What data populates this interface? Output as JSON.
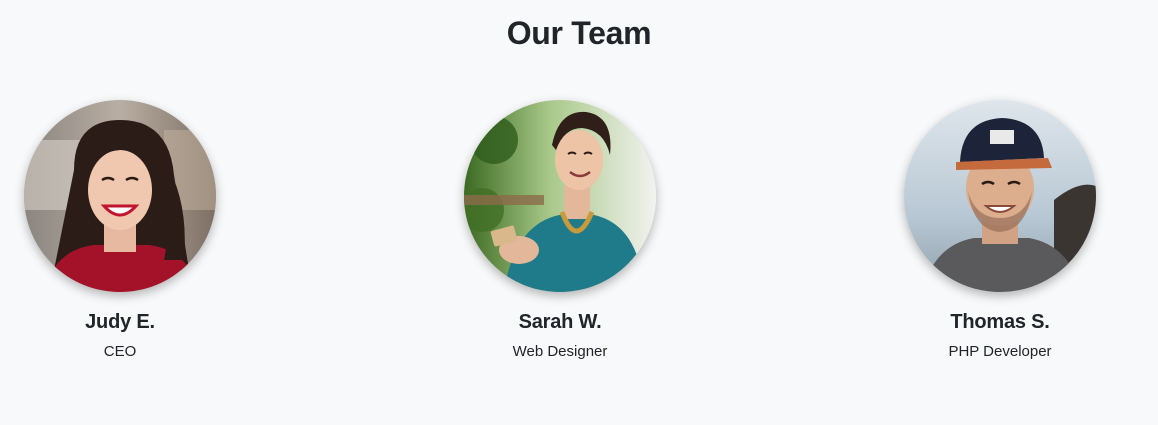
{
  "section": {
    "title": "Our Team"
  },
  "members": [
    {
      "name": "Judy E.",
      "role": "CEO"
    },
    {
      "name": "Sarah W.",
      "role": "Web Designer"
    },
    {
      "name": "Thomas S.",
      "role": "PHP Developer"
    }
  ],
  "colors": {
    "background": "#f8f9fa",
    "text": "#212529"
  }
}
